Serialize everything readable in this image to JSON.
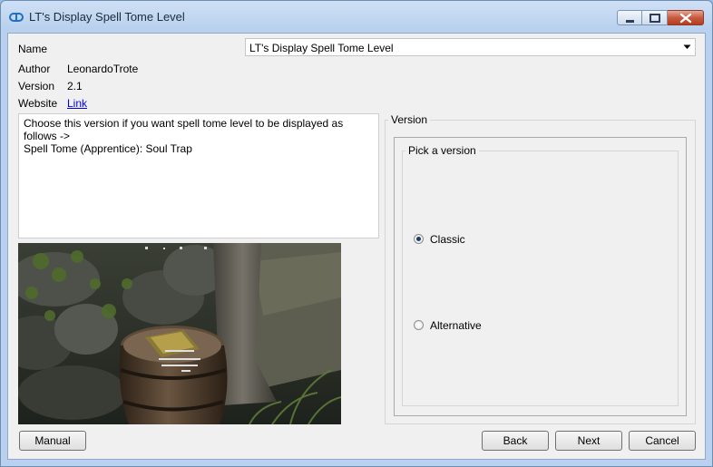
{
  "window": {
    "title": "LT's Display Spell Tome Level"
  },
  "info": {
    "name_label": "Name",
    "name_value": "LT's Display Spell Tome Level",
    "author_label": "Author",
    "author_value": "LeonardoTrote",
    "version_label": "Version",
    "version_value": "2.1",
    "website_label": "Website",
    "website_link": "Link"
  },
  "description": "Choose this version if you want spell tome level to be displayed as follows ->\nSpell Tome (Apprentice): Soul Trap",
  "version_group": {
    "title": "Version",
    "pick_title": "Pick a version",
    "options": [
      {
        "label": "Classic",
        "selected": true
      },
      {
        "label": "Alternative",
        "selected": false
      }
    ]
  },
  "buttons": {
    "manual": "Manual",
    "back": "Back",
    "next": "Next",
    "cancel": "Cancel"
  },
  "colors": {
    "link": "#0000ee",
    "title_bar": "#b9d1ee",
    "close_button": "#c75a3f"
  },
  "icons": {
    "app": "infinity-link-icon",
    "minimize": "minimize-icon",
    "maximize": "maximize-icon",
    "close": "close-icon",
    "dropdown": "chevron-down-icon"
  }
}
